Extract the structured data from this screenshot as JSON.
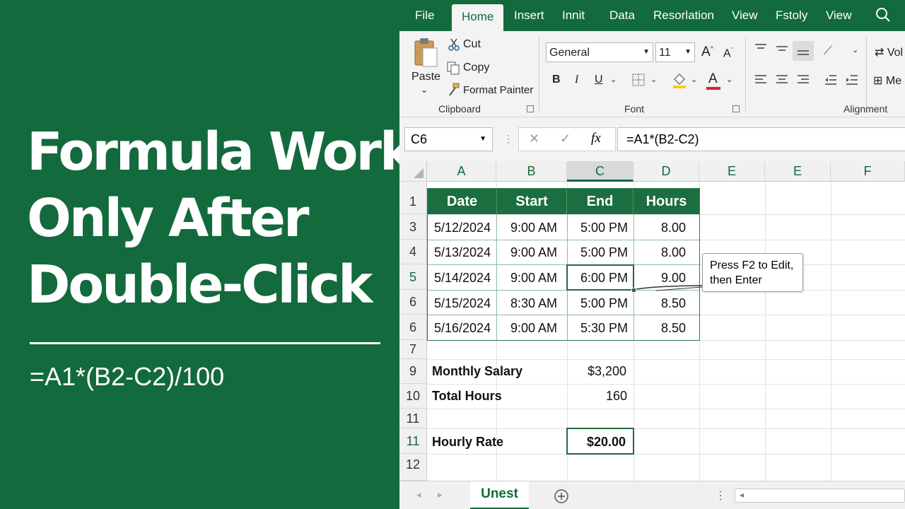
{
  "headline": {
    "line1": "Formula Works",
    "line2": "Only After",
    "line3": "Double-Click"
  },
  "left_formula": "=A1*(B2-C2)/100",
  "ribbon_tabs": [
    {
      "label": "File"
    },
    {
      "label": "Home"
    },
    {
      "label": "Insert"
    },
    {
      "label": "Innit"
    },
    {
      "label": "Data"
    },
    {
      "label": "Resorlation"
    },
    {
      "label": "View"
    },
    {
      "label": "Fstoly"
    },
    {
      "label": "View"
    }
  ],
  "clipboard": {
    "paste": "Paste",
    "cut": "Cut",
    "copy": "Copy",
    "format_painter": "Format Painter",
    "group_label": "Clipboard"
  },
  "font": {
    "name": "General",
    "size": "11",
    "bold": "B",
    "italic": "I",
    "underline": "U",
    "grow": "A",
    "shrink": "A",
    "font_color": "A",
    "group_label": "Font"
  },
  "alignment": {
    "wrap": "Vol",
    "merge": "Me",
    "group_label": "Alignment"
  },
  "formula_bar": {
    "name_box": "C6",
    "cancel": "✕",
    "enter": "✓",
    "fx": "fx",
    "formula": "=A1*(B2-C2)"
  },
  "columns": [
    "A",
    "B",
    "C",
    "D",
    "E",
    "E",
    "F"
  ],
  "row_headers": [
    "1",
    "3",
    "4",
    "5",
    "6",
    "6",
    "7",
    "9",
    "10",
    "11",
    "11",
    "12"
  ],
  "table": {
    "headers": [
      "Date",
      "Start",
      "End",
      "Hours"
    ],
    "rows": [
      [
        "5/12/2024",
        "9:00 AM",
        "5:00 PM",
        "8.00"
      ],
      [
        "5/13/2024",
        "9:00 AM",
        "5:00 PM",
        "8.00"
      ],
      [
        "5/14/2024",
        "9:00 AM",
        "6:00 PM",
        "9.00"
      ],
      [
        "5/15/2024",
        "8:30 AM",
        "5:00 PM",
        "8.50"
      ],
      [
        "5/16/2024",
        "9:00 AM",
        "5:30 PM",
        "8.50"
      ]
    ]
  },
  "summary": {
    "monthly_salary_label": "Monthly Salary",
    "monthly_salary_value": "$3,200",
    "total_hours_label": "Total Hours",
    "total_hours_value": "160",
    "hourly_rate_label": "Hourly Rate",
    "hourly_rate_value": "$20.00"
  },
  "callout": {
    "line1": "Press F2 to Edit,",
    "line2": "then Enter"
  },
  "sheet_tabs": [
    {
      "label": "Unest"
    }
  ],
  "colors": {
    "brand_green": "#136a3c",
    "header_green": "#1b6e3f"
  }
}
